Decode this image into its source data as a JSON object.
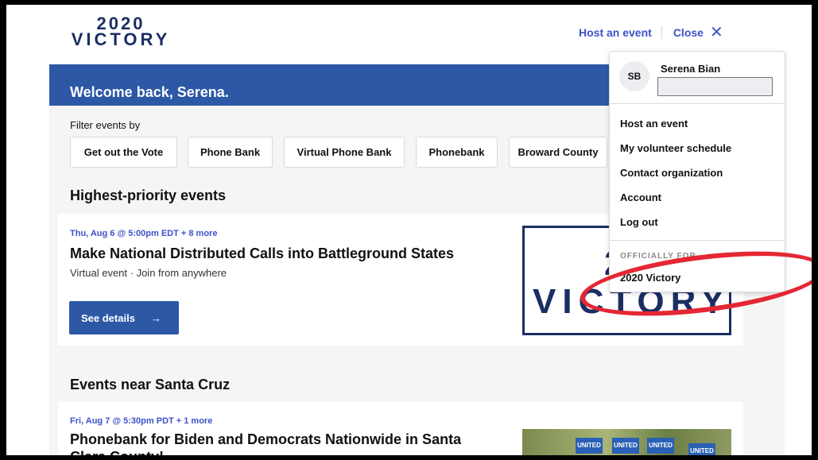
{
  "header": {
    "logo_line1": "2020",
    "logo_line2": "VICTORY",
    "host_link": "Host an event",
    "close_link": "Close",
    "close_icon": "✕"
  },
  "banner": {
    "welcome": "Welcome back, Serena."
  },
  "filters": {
    "label": "Filter events by",
    "chips": [
      "Get out the Vote",
      "Phone Bank",
      "Virtual Phone Bank",
      "Phonebank",
      "Broward County"
    ]
  },
  "priority": {
    "heading": "Highest-priority events",
    "event": {
      "date": "Thu, Aug 6 @ 5:00pm EDT + 8 more",
      "title": "Make National Distributed Calls into Battleground States",
      "location": "Virtual event · Join from anywhere",
      "button": "See details",
      "button_icon": "→",
      "logo_line1": "2020",
      "logo_line2": "VICTORY"
    }
  },
  "nearby": {
    "heading": "Events near Santa Cruz",
    "event": {
      "date": "Fri, Aug 7 @ 5:30pm PDT + 1 more",
      "title": "Phonebank for Biden and Democrats Nationwide in Santa Clara County!",
      "sign_text": "UNITED"
    }
  },
  "dropdown": {
    "initials": "SB",
    "name": "Serena Bian",
    "items": [
      "Host an event",
      "My volunteer schedule",
      "Contact organization",
      "Account",
      "Log out"
    ],
    "org_label": "OFFICIALLY FOR",
    "org": "2020 Victory"
  },
  "colors": {
    "brand": "#1b2e63",
    "accent": "#2d58a6",
    "link": "#3e52c9",
    "annotation": "#e52734"
  }
}
